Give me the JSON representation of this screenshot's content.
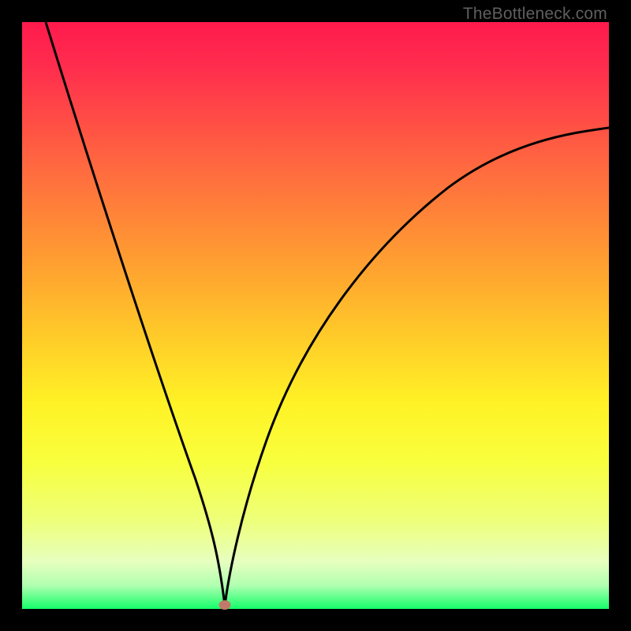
{
  "watermark": "TheBottleneck.com",
  "chart_data": {
    "type": "line",
    "title": "",
    "xlabel": "",
    "ylabel": "",
    "xlim": [
      0,
      1
    ],
    "ylim": [
      0,
      1
    ],
    "grid": false,
    "legend": false,
    "marker": {
      "x": 0.345,
      "y": 0.005,
      "color": "#c17a6a"
    },
    "series": [
      {
        "name": "left-curve",
        "x": [
          0.04,
          0.08,
          0.13,
          0.18,
          0.23,
          0.27,
          0.3,
          0.32,
          0.335,
          0.345
        ],
        "values": [
          1.0,
          0.87,
          0.71,
          0.55,
          0.39,
          0.25,
          0.14,
          0.06,
          0.02,
          0.005
        ]
      },
      {
        "name": "right-curve",
        "x": [
          0.345,
          0.36,
          0.39,
          0.43,
          0.48,
          0.54,
          0.61,
          0.69,
          0.78,
          0.88,
          1.0
        ],
        "values": [
          0.005,
          0.03,
          0.11,
          0.23,
          0.37,
          0.49,
          0.59,
          0.67,
          0.73,
          0.78,
          0.82
        ]
      }
    ],
    "gradient_colors": {
      "top": "#ff1a4d",
      "mid": "#ffd028",
      "bottom": "#14ff6a"
    },
    "curve_color": "#000000"
  }
}
